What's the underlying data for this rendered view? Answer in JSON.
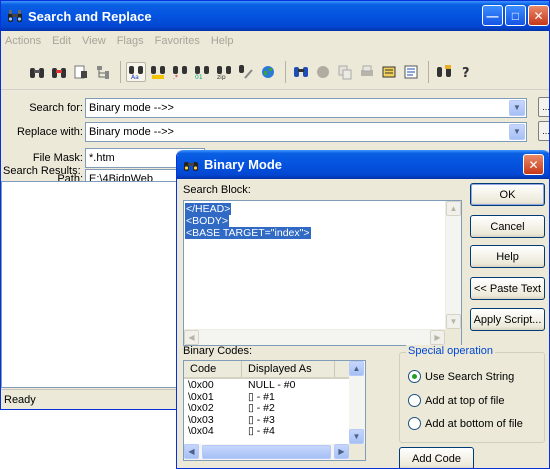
{
  "main_window": {
    "title": "Search and Replace",
    "menu": [
      "Actions",
      "Edit",
      "View",
      "Flags",
      "Favorites",
      "Help"
    ],
    "search_for": {
      "label": "Search for:",
      "value": "Binary mode -->>"
    },
    "replace_with": {
      "label": "Replace with:",
      "value": "Binary mode -->>"
    },
    "file_mask": {
      "label": "File Mask:",
      "value": "*.htm"
    },
    "path": {
      "label": "Path:",
      "value": "E:\\4BidpWeb"
    },
    "browse_label": "...",
    "results_label": "Search Results:",
    "status": "Ready"
  },
  "dialog": {
    "title": "Binary Mode",
    "search_block_label": "Search Block:",
    "search_block_lines": [
      "</HEAD>",
      "<BODY>",
      "<BASE TARGET=\"index\">"
    ],
    "buttons": {
      "ok": "OK",
      "cancel": "Cancel",
      "help": "Help",
      "paste_text": "<< Paste Text",
      "apply_script": "Apply Script...",
      "add_code": "Add Code"
    },
    "binary_codes_label": "Binary Codes:",
    "table_headers": [
      "Code",
      "Displayed As"
    ],
    "table_rows": [
      {
        "code": "\\0x00",
        "display": "NULL - #0"
      },
      {
        "code": "\\0x01",
        "display": "▯ - #1"
      },
      {
        "code": "\\0x02",
        "display": "▯ - #2"
      },
      {
        "code": "\\0x03",
        "display": "▯ - #3"
      },
      {
        "code": "\\0x04",
        "display": "▯ - #4"
      }
    ],
    "special_operation": {
      "legend": "Special operation",
      "options": [
        "Use Search String",
        "Add at top of file",
        "Add at bottom of file"
      ],
      "selected_index": 0
    }
  },
  "colors": {
    "title_bar": "#0453e0",
    "selection": "#316ac5",
    "window_bg": "#ece9d8",
    "group_legend": "#0046d5"
  },
  "icons": [
    "binoculars-icon",
    "minimize-icon",
    "maximize-icon",
    "close-icon",
    "dropdown-arrow-icon",
    "radio-selected-icon"
  ]
}
